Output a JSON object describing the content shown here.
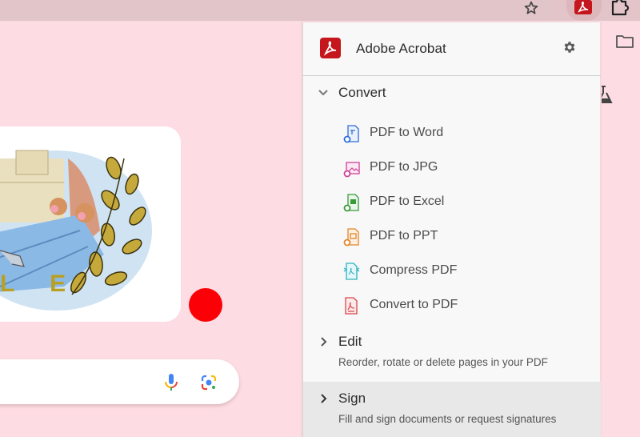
{
  "browser": {
    "bookmark_icon": "star-icon",
    "extension_icon": "adobe-acrobat-icon",
    "extensions_menu_icon": "puzzle-icon",
    "side_icons": [
      "folder-icon",
      "flask-icon"
    ]
  },
  "page": {
    "doodle_text": "L E",
    "search_icons": [
      "microphone-icon",
      "google-lens-icon"
    ]
  },
  "popup": {
    "title": "Adobe Acrobat",
    "settings_icon": "gear-icon",
    "sections": {
      "convert": {
        "label": "Convert",
        "expanded": true,
        "items": [
          {
            "label": "PDF to Word",
            "icon": "pdf-to-word-icon",
            "color": "#2d6fd6"
          },
          {
            "label": "PDF to JPG",
            "icon": "pdf-to-jpg-icon",
            "color": "#d0409a"
          },
          {
            "label": "PDF to Excel",
            "icon": "pdf-to-excel-icon",
            "color": "#3a9a3a"
          },
          {
            "label": "PDF to PPT",
            "icon": "pdf-to-ppt-icon",
            "color": "#e2862a"
          },
          {
            "label": "Compress PDF",
            "icon": "compress-pdf-icon",
            "color": "#2bb3c0"
          },
          {
            "label": "Convert to PDF",
            "icon": "convert-to-pdf-icon",
            "color": "#d9434a"
          }
        ]
      },
      "edit": {
        "label": "Edit",
        "description": "Reorder, rotate or delete pages in your PDF",
        "expanded": false
      },
      "sign": {
        "label": "Sign",
        "description": "Fill and sign documents or request signatures",
        "expanded": false,
        "highlighted": true
      }
    }
  },
  "colors": {
    "background": "#fddde3",
    "acrobat_red": "#c4161c",
    "record_dot": "#fb0007"
  }
}
